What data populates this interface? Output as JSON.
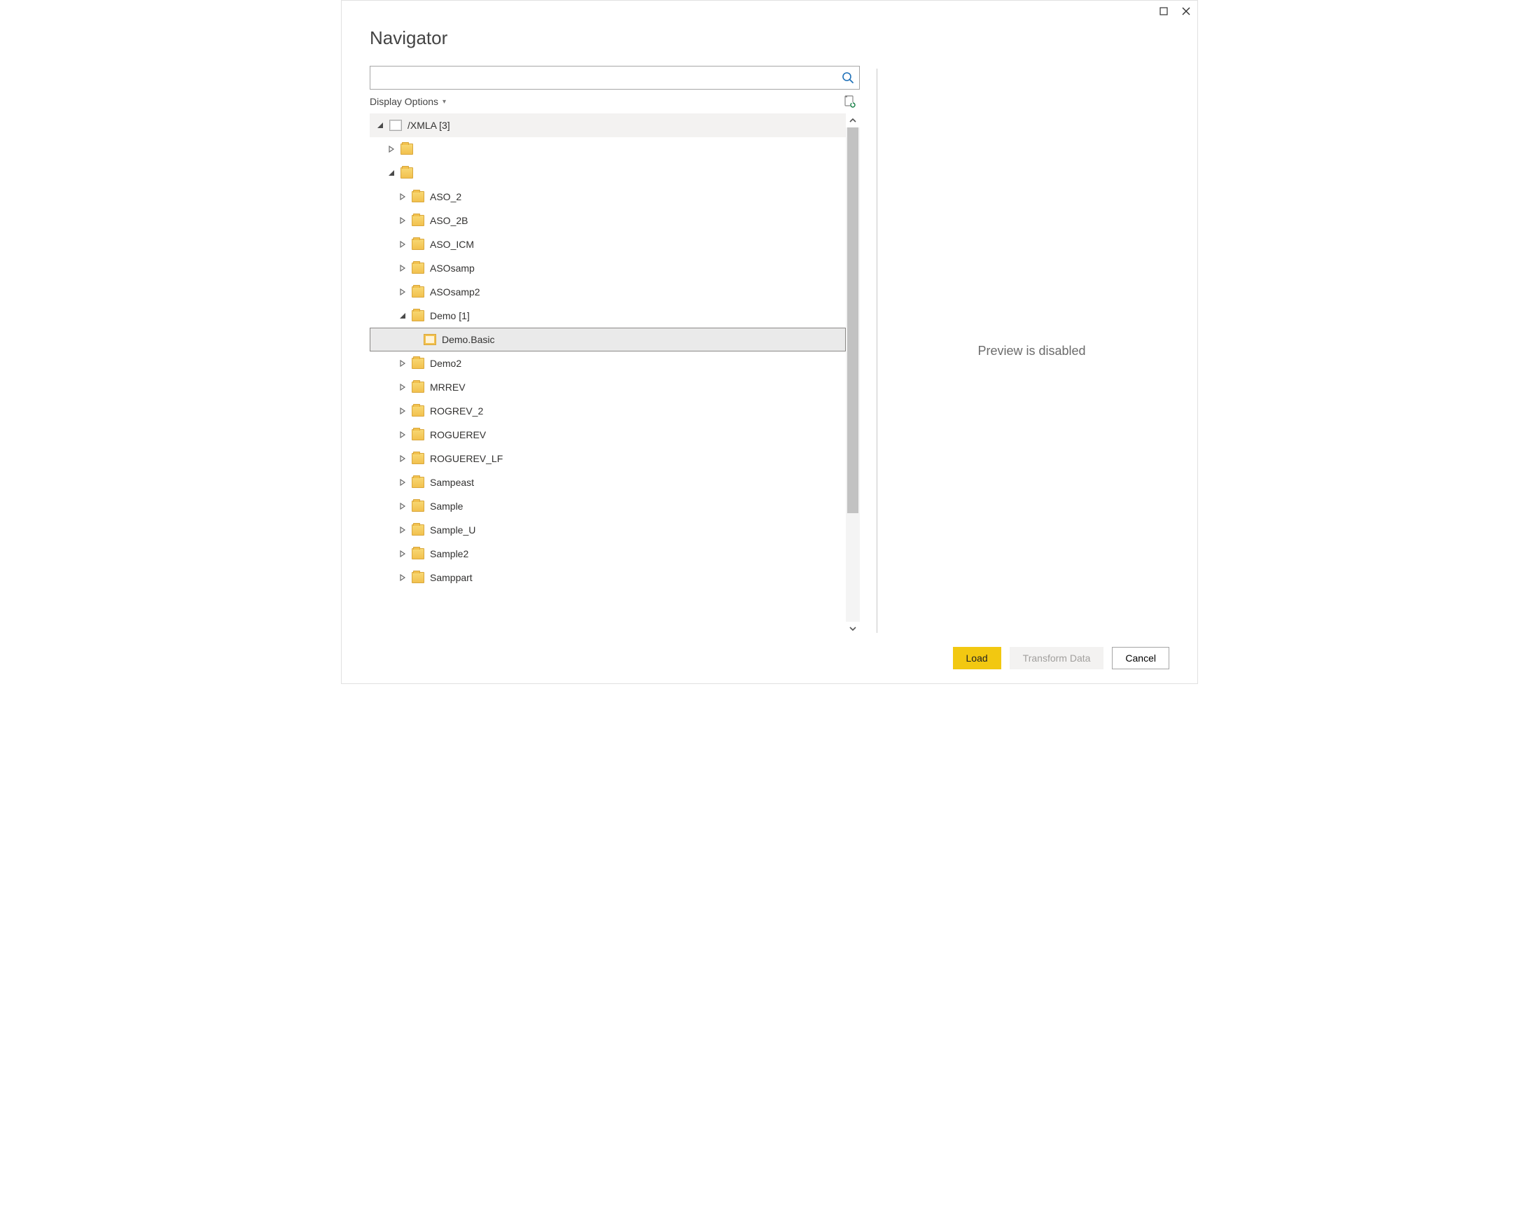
{
  "window": {
    "title": "Navigator"
  },
  "search": {
    "value": ""
  },
  "options": {
    "display_label": "Display Options"
  },
  "tree": {
    "root": {
      "label": "/XMLA [3]",
      "expanded": true,
      "icon": "db"
    },
    "nodes": [
      {
        "level": 1,
        "expanded": false,
        "icon": "folder",
        "label": ""
      },
      {
        "level": 1,
        "expanded": true,
        "icon": "folder",
        "label": "",
        "children": [
          {
            "level": 2,
            "expanded": false,
            "icon": "folder",
            "label": "ASO_2"
          },
          {
            "level": 2,
            "expanded": false,
            "icon": "folder",
            "label": "ASO_2B"
          },
          {
            "level": 2,
            "expanded": false,
            "icon": "folder",
            "label": "ASO_ICM"
          },
          {
            "level": 2,
            "expanded": false,
            "icon": "folder",
            "label": "ASOsamp"
          },
          {
            "level": 2,
            "expanded": false,
            "icon": "folder",
            "label": "ASOsamp2"
          },
          {
            "level": 2,
            "expanded": true,
            "icon": "folder",
            "label": "Demo [1]",
            "children": [
              {
                "level": 3,
                "expanded": null,
                "icon": "cube",
                "label": "Demo.Basic",
                "selected": true
              }
            ]
          },
          {
            "level": 2,
            "expanded": false,
            "icon": "folder",
            "label": "Demo2"
          },
          {
            "level": 2,
            "expanded": false,
            "icon": "folder",
            "label": "MRREV"
          },
          {
            "level": 2,
            "expanded": false,
            "icon": "folder",
            "label": "ROGREV_2"
          },
          {
            "level": 2,
            "expanded": false,
            "icon": "folder",
            "label": "ROGUEREV"
          },
          {
            "level": 2,
            "expanded": false,
            "icon": "folder",
            "label": "ROGUEREV_LF"
          },
          {
            "level": 2,
            "expanded": false,
            "icon": "folder",
            "label": "Sampeast"
          },
          {
            "level": 2,
            "expanded": false,
            "icon": "folder",
            "label": "Sample"
          },
          {
            "level": 2,
            "expanded": false,
            "icon": "folder",
            "label": "Sample_U"
          },
          {
            "level": 2,
            "expanded": false,
            "icon": "folder",
            "label": "Sample2"
          },
          {
            "level": 2,
            "expanded": false,
            "icon": "folder",
            "label": "Samppart"
          }
        ]
      }
    ]
  },
  "preview": {
    "message": "Preview is disabled"
  },
  "footer": {
    "load": "Load",
    "transform": "Transform Data",
    "cancel": "Cancel"
  }
}
